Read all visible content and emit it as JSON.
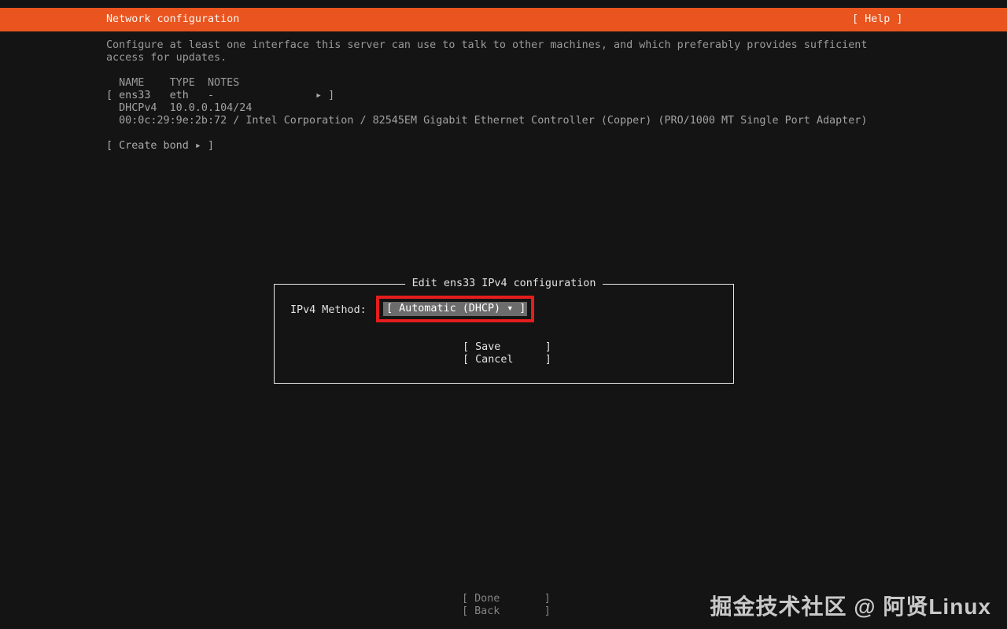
{
  "titlebar": {
    "title": "Network configuration",
    "help_label": "[ Help ]"
  },
  "intro": {
    "line1": "Configure at least one interface this server can use to talk to other machines, and which preferably provides sufficient",
    "line2": "access for updates."
  },
  "nic_table": {
    "header": "  NAME    TYPE  NOTES",
    "row_text": "[ ens33   eth   -                ",
    "row_arrow_icon": "▸",
    "row_close": " ]",
    "dhcp_line": "  DHCPv4  10.0.0.104/24",
    "mac_line": "  00:0c:29:9e:2b:72 / Intel Corporation / 82545EM Gigabit Ethernet Controller (Copper) (PRO/1000 MT Single Port Adapter)"
  },
  "create_bond": {
    "text": "[ Create bond ",
    "arrow_icon": "▸",
    "close": " ]"
  },
  "dialog": {
    "title": "Edit ens33 IPv4 configuration",
    "ipv4_method_label": "IPv4 Method:",
    "ipv4_method_value": "[ Automatic (DHCP) ",
    "caret_icon": "▾",
    "bracket_close": " ]",
    "save_label": "[ Save       ]",
    "cancel_label": "[ Cancel     ]"
  },
  "footer": {
    "done_label": "[ Done       ]",
    "back_label": "[ Back       ]"
  },
  "watermark": "掘金技术社区 @ 阿贤Linux",
  "colors": {
    "accent": "#e9541f",
    "background": "#141414",
    "text-dim": "#9a9a9a",
    "text-bright": "#e2e2e2",
    "select-bg": "#6c6c6c",
    "annotation": "#e41d1d",
    "footer-dim": "#848484",
    "watermark": "#c9c9c9"
  }
}
